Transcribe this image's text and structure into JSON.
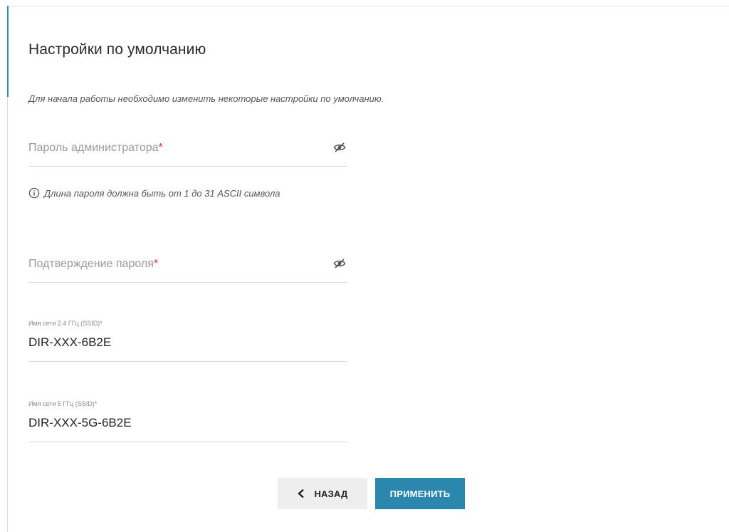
{
  "page": {
    "title": "Настройки по умолчанию",
    "intro": "Для начала работы необходимо изменить некоторые настройки по умолчанию."
  },
  "fields": {
    "admin_password": {
      "placeholder": "Пароль администратора",
      "required_mark": "*",
      "visibility_icon": "eye-off-icon"
    },
    "password_hint": {
      "icon": "info-icon",
      "text": "Длина пароля должна быть от 1 до 31 ASCII символа"
    },
    "confirm_password": {
      "placeholder": "Подтверждение пароля",
      "required_mark": "*",
      "visibility_icon": "eye-off-icon"
    },
    "ssid_24": {
      "label": "Имя сети 2.4 ГГц (SSID)*",
      "value": "DIR-XXX-6B2E"
    },
    "ssid_5": {
      "label": "Имя сети 5 ГГц (SSID)*",
      "value": "DIR-XXX-5G-6B2E"
    }
  },
  "buttons": {
    "back_label": "НАЗАД",
    "back_icon": "chevron-left-icon",
    "apply_label": "ПРИМЕНИТЬ"
  },
  "colors": {
    "accent": "#2f8fb0",
    "apply_button": "#2b87ad",
    "required": "#d6322e"
  }
}
